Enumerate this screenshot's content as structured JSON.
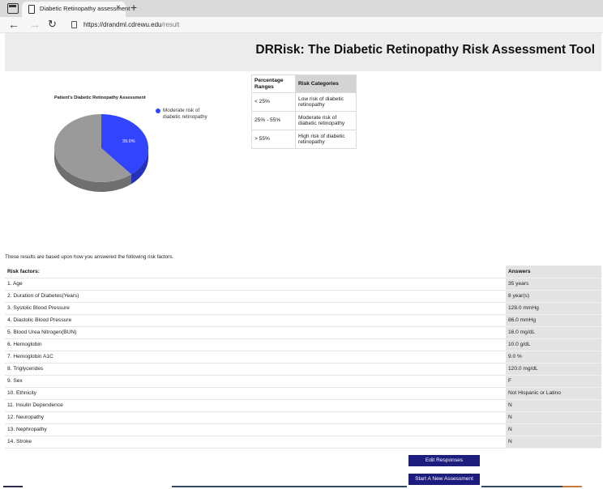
{
  "browser": {
    "tab_title": "Diabetic Retinopathy assessment",
    "tab_close": "×",
    "new_tab": "+",
    "url_host": "https://drandml.cdrewu.edu",
    "url_path": "/result"
  },
  "header": {
    "title": "DRRisk: The Diabetic Retinopathy Risk Assessment Tool"
  },
  "chart_data": {
    "type": "pie",
    "title": "Patient's Diabetic Retinopathy Assessment",
    "slices": [
      {
        "label": "Moderate risk of diabetic retinopathy",
        "value": 39.0,
        "color": "#3344ff",
        "data_label": "39.0%"
      },
      {
        "label": "",
        "value": 61.0,
        "color": "#9a9a9a",
        "data_label": ""
      }
    ],
    "legend": [
      "Moderate risk of diabetic retinopathy"
    ],
    "legend_placement": "top-right"
  },
  "categories_table": {
    "headers": [
      "Percentage Ranges",
      "Risk Categories"
    ],
    "rows": [
      [
        "< 25%",
        "Low risk of diabetic retinopathy"
      ],
      [
        "25% - 55%",
        "Moderate risk of diabetic retinopathy"
      ],
      [
        "> 55%",
        "High risk of diabetic retinopathy"
      ]
    ]
  },
  "results_intro": "These results are based upon how you answered the following risk factors.",
  "risk_table": {
    "headers": [
      "Risk factors:",
      "Answers"
    ],
    "rows": [
      [
        "1. Age",
        "35 years"
      ],
      [
        "2. Duration of Diabetes(Years)",
        "8 year(s)"
      ],
      [
        "3. Systolic Blood Pressure",
        "128.0 mmHg"
      ],
      [
        "4. Diastolic Blood Pressure",
        "86.0 mmHg"
      ],
      [
        "5. Blood Urea Nitrogen(BUN)",
        "16.0 mg/dL"
      ],
      [
        "6. Hemoglobin",
        "10.0 g/dL"
      ],
      [
        "7. Hemoglobin A1C",
        "9.0 %"
      ],
      [
        "8. Triglycerides",
        "120.0 mg/dL"
      ],
      [
        "9. Sex",
        "F"
      ],
      [
        "10. Ethnicity",
        "Not Hispanic or Latino"
      ],
      [
        "11. Insulin Dependence",
        "N"
      ],
      [
        "12. Neuropathy",
        "N"
      ],
      [
        "13. Nephropathy",
        "N"
      ],
      [
        "14. Stroke",
        "N"
      ]
    ]
  },
  "buttons": {
    "edit": "Edit Responses",
    "new": "Start A New Assessment"
  }
}
